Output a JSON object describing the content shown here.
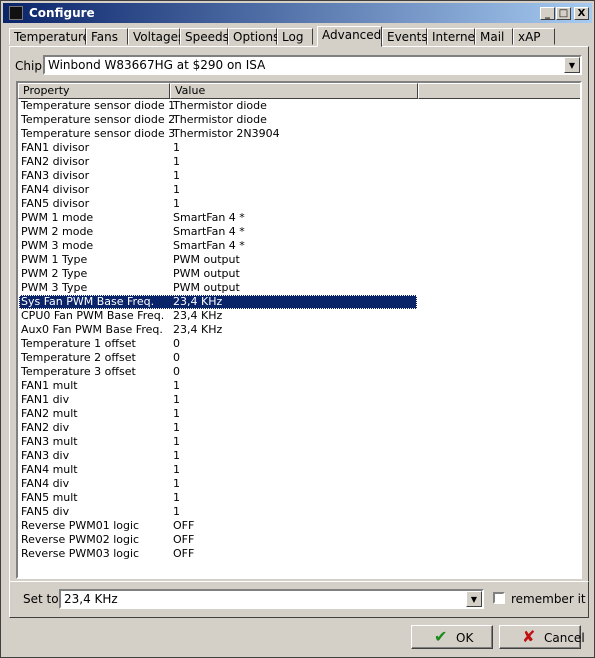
{
  "window": {
    "title": "Configure",
    "controls": [
      "_",
      "□",
      "X"
    ]
  },
  "tabs": [
    "Temperatures",
    "Fans",
    "Voltages",
    "Speeds",
    "Options",
    "Log",
    "Advanced",
    "Events",
    "Internet",
    "Mail",
    "xAP"
  ],
  "active_tab": "Advanced",
  "chip": {
    "label": "Chip",
    "value": "Winbond W83667HG at $290 on ISA"
  },
  "table": {
    "headers": [
      "Property",
      "Value"
    ],
    "selected_index": 14,
    "rows": [
      [
        "Temperature sensor diode 1",
        "Thermistor diode"
      ],
      [
        "Temperature sensor diode 2",
        "Thermistor diode"
      ],
      [
        "Temperature sensor diode 3",
        "Thermistor 2N3904"
      ],
      [
        "FAN1 divisor",
        "1"
      ],
      [
        "FAN2 divisor",
        "1"
      ],
      [
        "FAN3 divisor",
        "1"
      ],
      [
        "FAN4 divisor",
        "1"
      ],
      [
        "FAN5 divisor",
        "1"
      ],
      [
        "PWM 1 mode",
        "SmartFan 4 *"
      ],
      [
        "PWM 2 mode",
        "SmartFan 4 *"
      ],
      [
        "PWM 3 mode",
        "SmartFan 4 *"
      ],
      [
        "PWM 1 Type",
        "PWM output"
      ],
      [
        "PWM 2 Type",
        "PWM output"
      ],
      [
        "PWM 3 Type",
        "PWM output"
      ],
      [
        "Sys Fan PWM Base Freq.",
        "23,4 KHz"
      ],
      [
        "CPU0 Fan PWM Base Freq.",
        "23,4 KHz"
      ],
      [
        "Aux0 Fan PWM Base Freq.",
        "23,4 KHz"
      ],
      [
        "Temperature 1 offset",
        "0"
      ],
      [
        "Temperature 2 offset",
        "0"
      ],
      [
        "Temperature 3 offset",
        "0"
      ],
      [
        "FAN1 mult",
        "1"
      ],
      [
        "FAN1 div",
        "1"
      ],
      [
        "FAN2 mult",
        "1"
      ],
      [
        "FAN2 div",
        "1"
      ],
      [
        "FAN3 mult",
        "1"
      ],
      [
        "FAN3 div",
        "1"
      ],
      [
        "FAN4 mult",
        "1"
      ],
      [
        "FAN4 div",
        "1"
      ],
      [
        "FAN5 mult",
        "1"
      ],
      [
        "FAN5 div",
        "1"
      ],
      [
        "Reverse PWM01 logic",
        "OFF"
      ],
      [
        "Reverse PWM02 logic",
        "OFF"
      ],
      [
        "Reverse PWM03 logic",
        "OFF"
      ]
    ]
  },
  "set_to": {
    "label": "Set to",
    "value": "23,4 KHz"
  },
  "remember": {
    "label": "remember it",
    "checked": false
  },
  "buttons": {
    "ok": "OK",
    "cancel": "Cancel"
  },
  "colors": {
    "selection": "#0a246a",
    "title_bar": "#0a246a",
    "ok_icon": "#1a8a1a",
    "cancel_icon": "#c01010"
  }
}
